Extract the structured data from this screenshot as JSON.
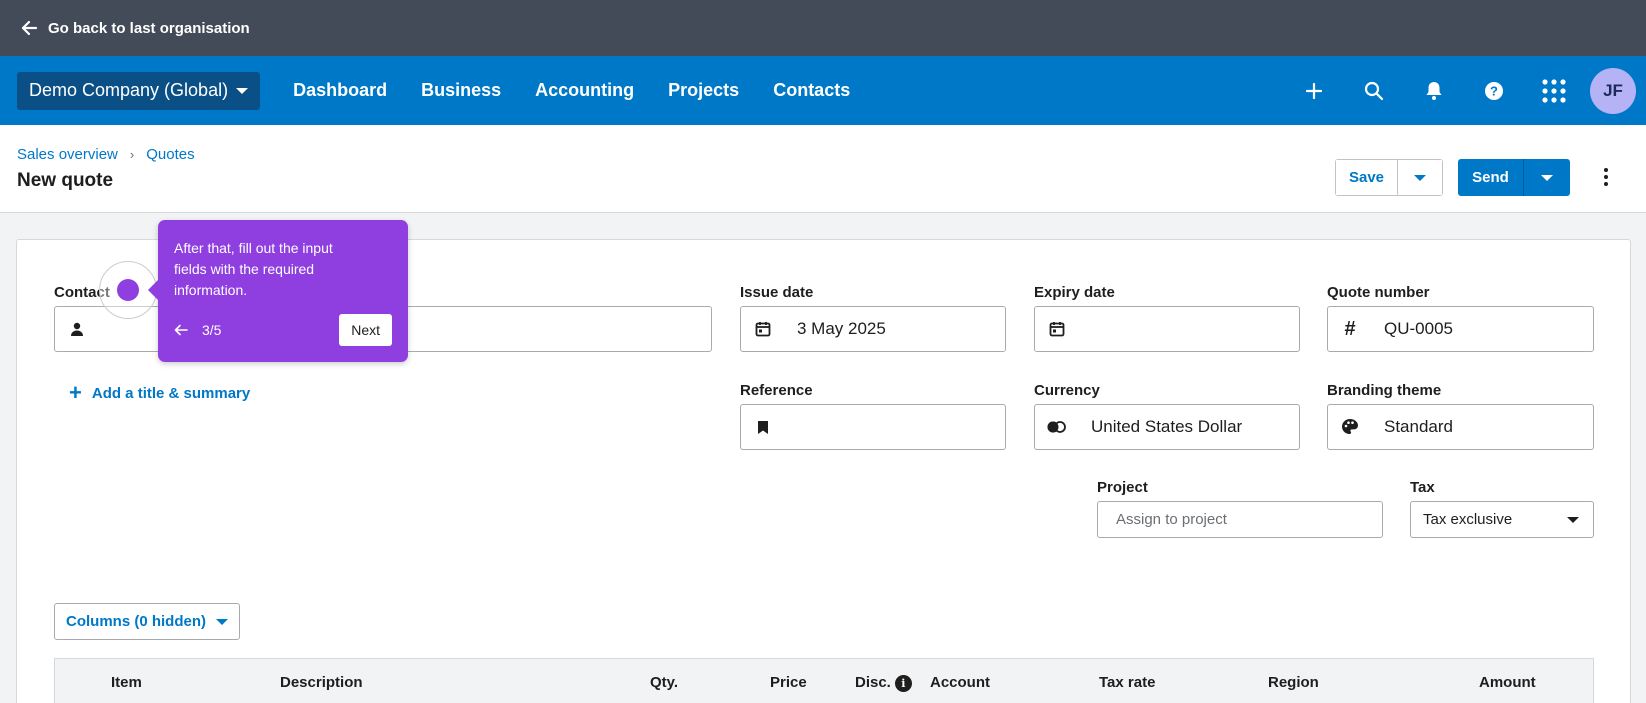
{
  "topbar": {
    "back_label": "Go back to last organisation"
  },
  "nav": {
    "org": "Demo Company (Global)",
    "links": [
      "Dashboard",
      "Business",
      "Accounting",
      "Projects",
      "Contacts"
    ],
    "icons": [
      "plus-icon",
      "search-icon",
      "bell-icon",
      "help-icon",
      "apps-grid-icon"
    ],
    "avatar_initials": "JF"
  },
  "header": {
    "breadcrumbs": [
      "Sales overview",
      "Quotes"
    ],
    "title": "New quote",
    "save_label": "Save",
    "send_label": "Send"
  },
  "form": {
    "contact": {
      "label": "Contact",
      "value": ""
    },
    "issue_date": {
      "label": "Issue date",
      "value": "3 May 2025"
    },
    "expiry_date": {
      "label": "Expiry date",
      "value": ""
    },
    "quote_number": {
      "label": "Quote number",
      "value": "QU-0005"
    },
    "add_title": "Add a title & summary",
    "reference": {
      "label": "Reference",
      "value": ""
    },
    "currency": {
      "label": "Currency",
      "value": "United States Dollar"
    },
    "branding": {
      "label": "Branding theme",
      "value": "Standard"
    },
    "project": {
      "label": "Project",
      "placeholder": "Assign to project"
    },
    "tax": {
      "label": "Tax",
      "value": "Tax exclusive"
    }
  },
  "columns_button": "Columns (0 hidden)",
  "table": {
    "headers": [
      "Item",
      "Description",
      "Qty.",
      "Price",
      "Disc.",
      "Account",
      "Tax rate",
      "Region",
      "Amount"
    ]
  },
  "tooltip": {
    "message": "After that, fill out the input fields with the required information.",
    "step": "3/5",
    "next_label": "Next",
    "color": "#8f3ee0"
  },
  "colors": {
    "nav": "#0078c8",
    "topbar": "#434a58",
    "accent": "#0078c8"
  }
}
